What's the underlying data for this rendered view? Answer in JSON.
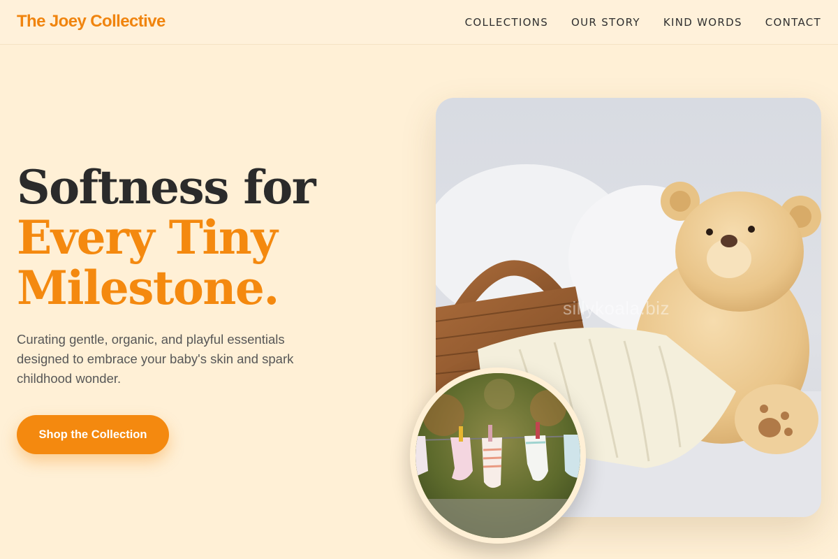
{
  "header": {
    "brand": "The Joey Collective",
    "nav": [
      "COLLECTIONS",
      "OUR STORY",
      "KIND WORDS",
      "CONTACT"
    ]
  },
  "hero": {
    "headline_line1": "Softness for",
    "headline_line2": "Every Tiny",
    "headline_line3": "Milestone.",
    "subtitle": "Curating gentle, organic, and playful essentials designed to embrace your baby's skin and spark childhood wonder.",
    "cta_label": "Shop the Collection"
  },
  "media": {
    "main_photo": "teddy-bear-basket-blanket-photo",
    "watermark": "sillykoala.biz",
    "inset_photo": "baby-socks-clothesline-photo"
  },
  "colors": {
    "background": "#fff0d6",
    "accent": "#f4890f",
    "heading": "#2b2b2b",
    "body_text": "#575757"
  }
}
